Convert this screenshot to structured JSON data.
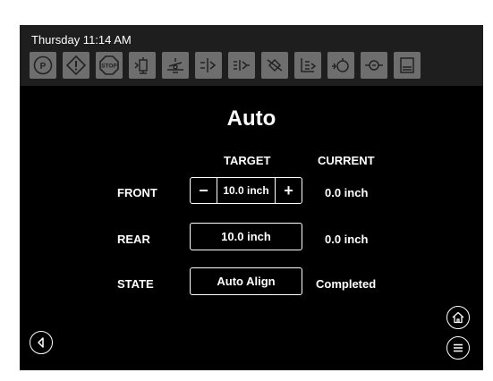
{
  "status_bar": {
    "datetime": "Thursday 11:14 AM"
  },
  "indicators": [
    {
      "icon": "parking-brake-icon",
      "text": "(P)"
    },
    {
      "icon": "warning-icon"
    },
    {
      "icon": "stop-icon",
      "text": "STOP"
    },
    {
      "icon": "jack-down-icon"
    },
    {
      "icon": "level-icon"
    },
    {
      "icon": "front-jack-icon"
    },
    {
      "icon": "rear-jack-icon"
    },
    {
      "icon": "jack-fault-icon"
    },
    {
      "icon": "slide-icon"
    },
    {
      "icon": "oil-pressure-icon"
    },
    {
      "icon": "fluid-level-icon"
    },
    {
      "icon": "door-icon"
    }
  ],
  "page": {
    "title": "Auto"
  },
  "columns": {
    "target": "TARGET",
    "current": "CURRENT"
  },
  "rows": {
    "front": {
      "label": "FRONT",
      "target": "10.0 inch",
      "current": "0.0 inch",
      "minus": "−",
      "plus": "+"
    },
    "rear": {
      "label": "REAR",
      "target": "10.0 inch",
      "current": "0.0 inch"
    },
    "state": {
      "label": "STATE",
      "target": "Auto Align",
      "current": "Completed"
    }
  },
  "nav": {
    "back": "back-icon",
    "home": "home-icon",
    "menu": "menu-icon"
  }
}
